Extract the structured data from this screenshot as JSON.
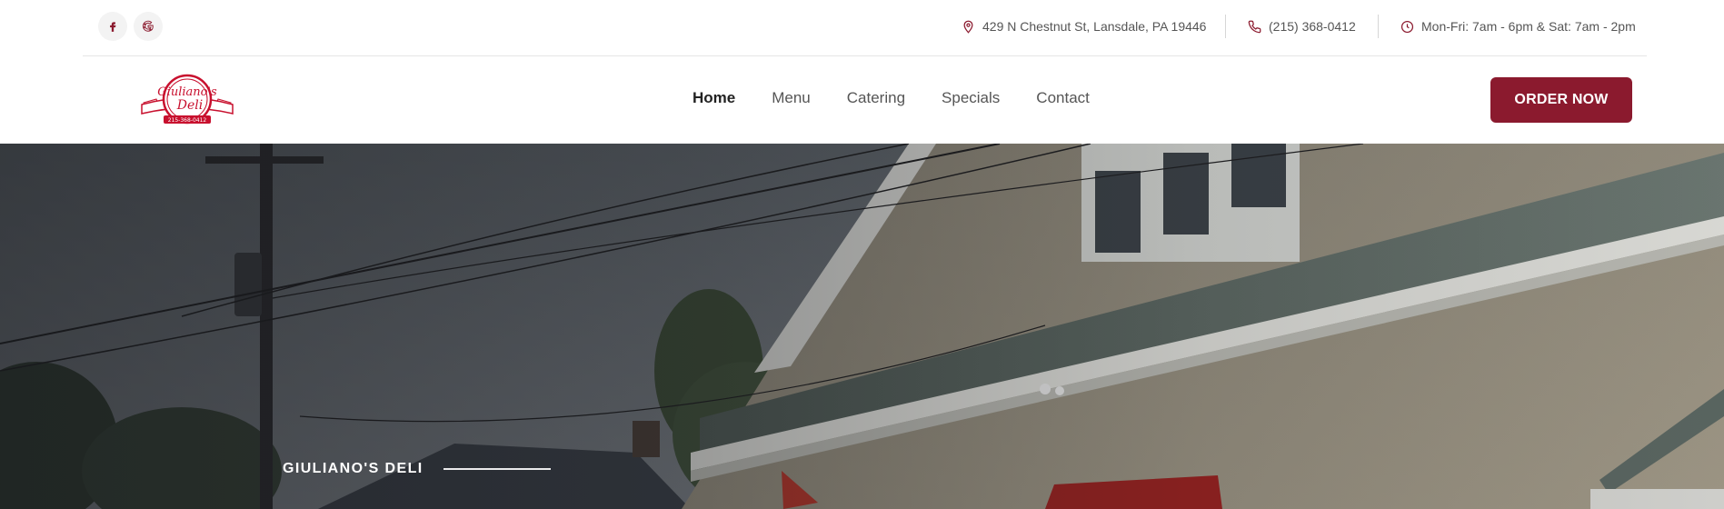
{
  "topbar": {
    "social": [
      {
        "icon": "facebook-icon",
        "label": "f"
      },
      {
        "icon": "google-icon",
        "label": "G"
      }
    ],
    "address": "429 N Chestnut St, Lansdale, PA 19446",
    "phone": "(215) 368-0412",
    "hours": "Mon-Fri: 7am - 6pm & Sat: 7am - 2pm",
    "icon_color": "#8b1a2e"
  },
  "header": {
    "logo": {
      "line1": "Giuliano's",
      "line2": "Deli",
      "phone": "215-368-0412"
    },
    "nav": [
      {
        "label": "Home",
        "active": true
      },
      {
        "label": "Menu",
        "active": false
      },
      {
        "label": "Catering",
        "active": false
      },
      {
        "label": "Specials",
        "active": false
      },
      {
        "label": "Contact",
        "active": false
      }
    ],
    "cta": "ORDER NOW",
    "accent": "#8b1a2e"
  },
  "hero": {
    "kicker": "GIULIANO'S DELI"
  }
}
